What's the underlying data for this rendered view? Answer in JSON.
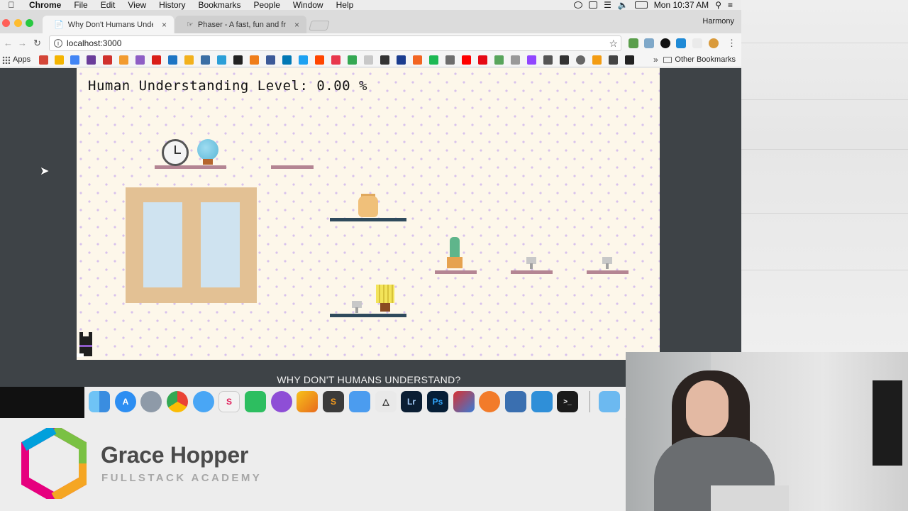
{
  "menubar": {
    "apple_symbol": "",
    "items": [
      "Chrome",
      "File",
      "Edit",
      "View",
      "History",
      "Bookmarks",
      "People",
      "Window",
      "Help"
    ],
    "clock": "Mon 10:37 AM",
    "status_icons": [
      "sync-icon",
      "screen-mirror-icon",
      "wifi-icon",
      "volume-icon",
      "battery-icon",
      "spotlight-icon",
      "notification-center-icon"
    ]
  },
  "browser": {
    "tabs": [
      {
        "title": "Why Don't Humans Understan",
        "close": "×"
      },
      {
        "title": "Phaser - A fast, fun and free o",
        "close": "×"
      }
    ],
    "profile_name": "Harmony",
    "address": "localhost:3000",
    "bookmarks_apps_label": "Apps",
    "other_bookmarks_label": "Other Bookmarks",
    "bookmarks_overflow": "»"
  },
  "game": {
    "hud_text": "Human Understanding Level: 0.00 %"
  },
  "caption": "WHY DON'T HUMANS UNDERSTAND?",
  "brand": {
    "title": "Grace Hopper",
    "subtitle": "FULLSTACK ACADEMY",
    "colors": [
      "#e6007e",
      "#f5a623",
      "#7ac143",
      "#00a0dc",
      "#6a3d9a"
    ]
  },
  "dock": {
    "apps": [
      "Finder",
      "App Store",
      "Launchpad",
      "Chrome",
      "Messages",
      "Slack",
      "Evernote",
      "Sketchbook",
      "Tes",
      "Sublime Text",
      "Xcode",
      "Unity",
      "Lightroom",
      "Photoshop",
      "Parallels",
      "Paw",
      "Tiled",
      "Mesh",
      "Terminal",
      "Folder"
    ]
  }
}
